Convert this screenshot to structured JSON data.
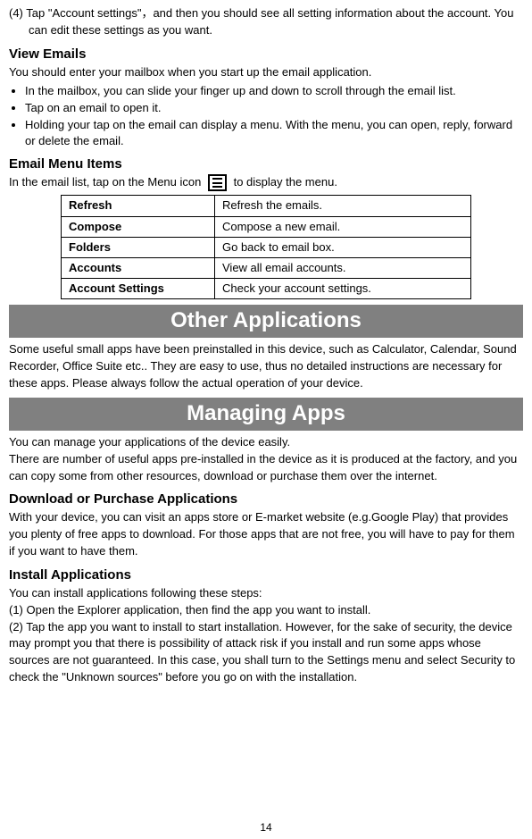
{
  "step4": "(4) Tap \"Account settings\"，and then you should see all setting information about the account. You can edit these settings as you want.",
  "view_emails": {
    "heading": "View Emails",
    "intro": "You should enter your mailbox when you start up the email application.",
    "bullets": [
      "In the mailbox, you can slide your finger up and down to scroll through the email list.",
      "Tap on an email to open it.",
      "Holding your tap on the email can display a menu. With the menu, you can open, reply, forward or delete the email."
    ]
  },
  "email_menu": {
    "heading": "Email Menu Items",
    "intro_pre": "In the email list, tap on the Menu icon ",
    "intro_post": " to display the menu.",
    "rows": [
      {
        "label": "Refresh",
        "desc": "Refresh the emails."
      },
      {
        "label": "Compose",
        "desc": "Compose a new email."
      },
      {
        "label": "Folders",
        "desc": "Go back to email box."
      },
      {
        "label": "Accounts",
        "desc": "View all email accounts."
      },
      {
        "label": "Account Settings",
        "desc": "Check your account settings."
      }
    ]
  },
  "other_apps": {
    "heading": "Other Applications",
    "body": "Some useful small apps have been preinstalled in this device, such as Calculator, Calendar, Sound Recorder, Office Suite etc..   They are easy to use, thus no detailed instructions are necessary for these apps. Please always follow the actual operation of your device."
  },
  "managing_apps": {
    "heading": "Managing Apps",
    "intro1": "You can manage your applications of the device easily.",
    "intro2": "There are number of useful apps pre-installed in the device as it is produced at the factory, and you can copy some from other resources, download or purchase them over the internet.",
    "download": {
      "heading": "Download or Purchase Applications",
      "body": "With your device, you can visit an apps store or E-market website (e.g.Google Play) that provides you plenty of free apps to download. For those apps that are not free, you will have to pay for them if you want to have them."
    },
    "install": {
      "heading": "Install Applications",
      "intro": "You can install applications following these steps:",
      "step1": "(1) Open the Explorer application, then find the app you want to install.",
      "step2": "(2) Tap the app you want to install to start installation. However, for the sake of security, the device may prompt you that there is possibility of attack risk if you install and run some apps whose sources are not guaranteed. In this case, you shall turn to the Settings menu and select Security to check the \"Unknown sources\" before you go on with the installation."
    }
  },
  "page_number": "14"
}
